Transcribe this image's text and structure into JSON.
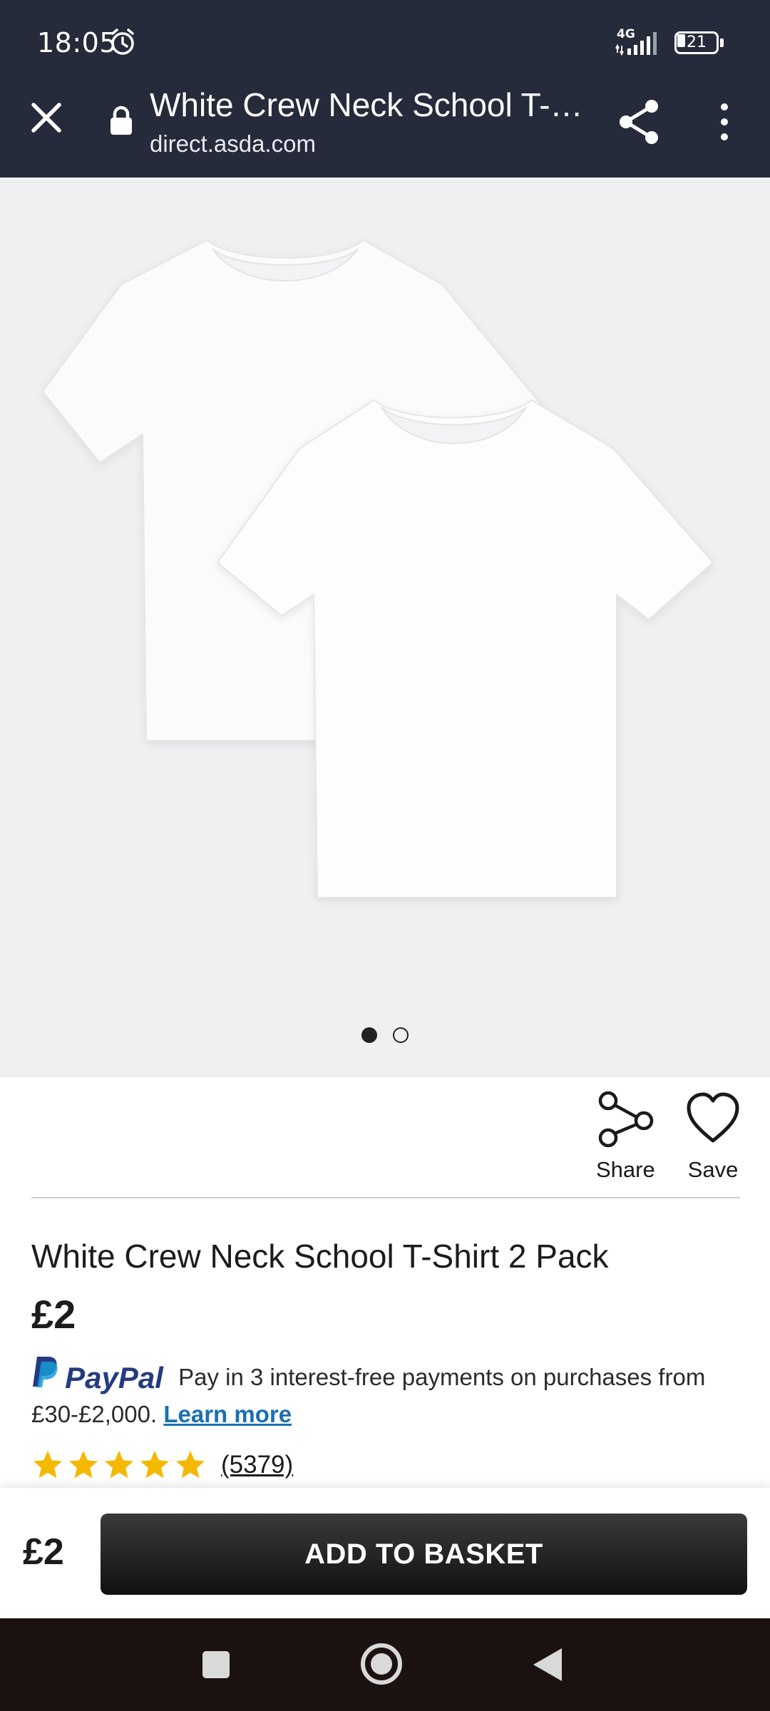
{
  "status_bar": {
    "time": "18:05",
    "network": "4G",
    "battery": "21"
  },
  "browser": {
    "page_title": "White Crew Neck School T-S...",
    "url": "direct.asda.com"
  },
  "gallery": {
    "image_count": 2,
    "active_index": 0
  },
  "actions": {
    "share_label": "Share",
    "save_label": "Save"
  },
  "product": {
    "title": "White Crew Neck School T-Shirt 2 Pack",
    "price": "£2"
  },
  "paypal": {
    "brand": "PayPal",
    "text": "Pay in 3 interest-free payments on purchases from £30-£2,000.",
    "link": "Learn more"
  },
  "rating": {
    "stars": 5,
    "max_stars": 5,
    "count": "(5379)"
  },
  "basket_bar": {
    "price": "£2",
    "button_label": "ADD TO BASKET"
  },
  "colors": {
    "header_bg": "#252b3a",
    "star": "#f5b800",
    "link": "#1a6fb0",
    "paypal_dark": "#253b80",
    "paypal_light": "#179bd7"
  }
}
